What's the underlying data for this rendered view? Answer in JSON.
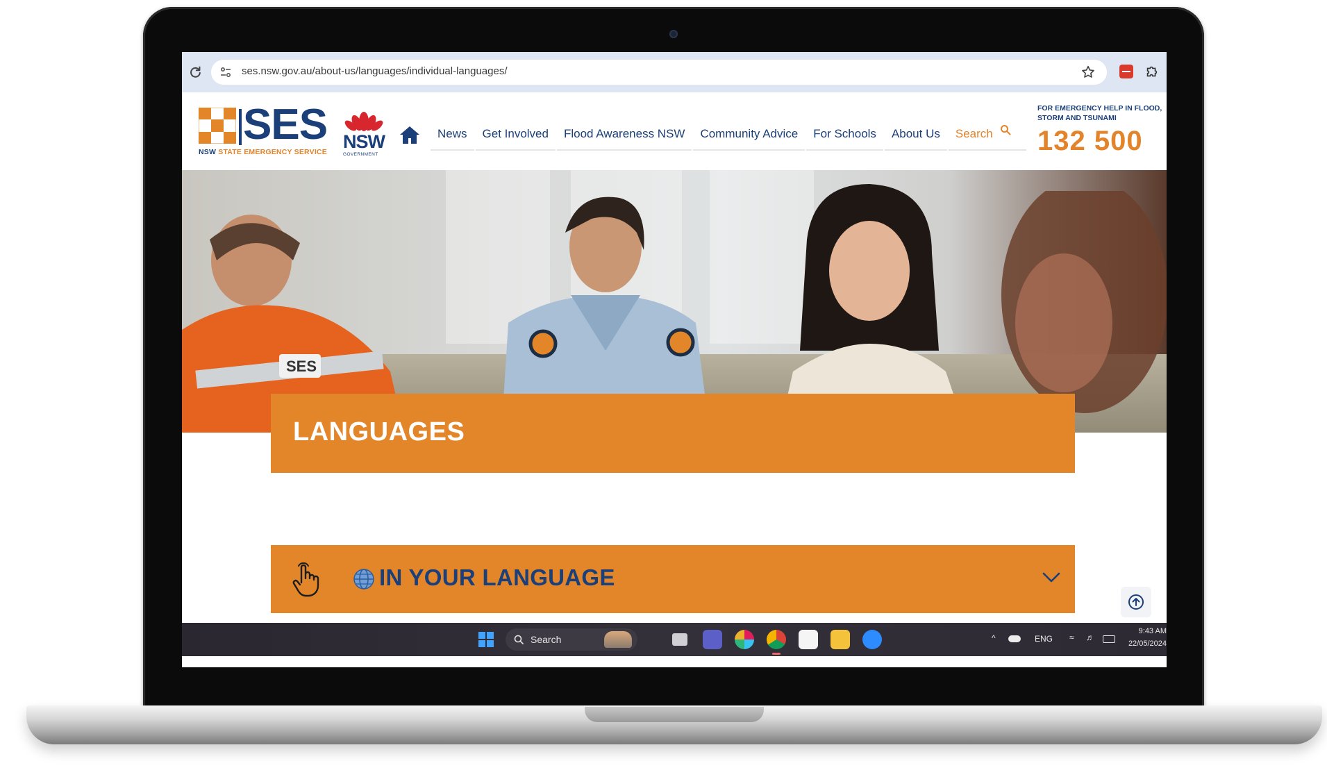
{
  "browser": {
    "url": "ses.nsw.gov.au/about-us/languages/individual-languages/"
  },
  "header": {
    "logo_word": "SES",
    "logo_tagline_prefix": "NSW",
    "logo_tagline": "STATE EMERGENCY SERVICE",
    "gov_logo_word": "NSW",
    "gov_logo_sub": "GOVERNMENT",
    "nav": [
      {
        "label": "News"
      },
      {
        "label": "Get Involved"
      },
      {
        "label": "Flood Awareness NSW"
      },
      {
        "label": "Community Advice"
      },
      {
        "label": "For Schools"
      },
      {
        "label": "About Us"
      },
      {
        "label": "Search"
      }
    ],
    "emergency_label": "FOR EMERGENCY HELP IN FLOOD, STORM AND TSUNAMI",
    "emergency_number": "132 500"
  },
  "hero": {
    "vest_text": "SES"
  },
  "main": {
    "page_title": "LANGUAGES",
    "accordion_title": "IN YOUR LANGUAGE"
  },
  "taskbar": {
    "search_label": "Search",
    "language": "ENG",
    "time": "9:43 AM",
    "date": "22/05/2024"
  },
  "colors": {
    "brand_orange": "#e3862a",
    "brand_navy": "#1b3f78"
  },
  "icons": [
    "reload-icon",
    "site-info-icon",
    "star-icon",
    "extension-icon",
    "puzzle-icon",
    "home-icon",
    "search-icon",
    "hand-pointer-icon",
    "globe-icon",
    "chevron-down-icon",
    "arrow-up-icon",
    "windows-start-icon"
  ]
}
